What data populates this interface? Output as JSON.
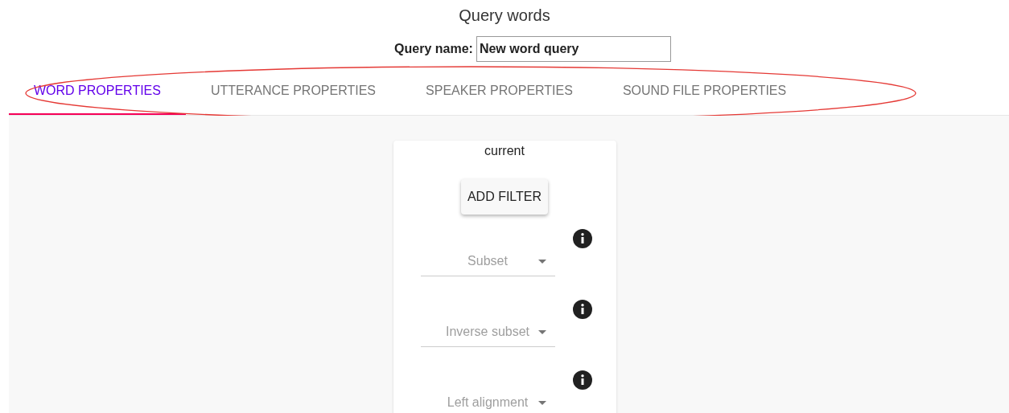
{
  "title": "Query words",
  "query_name": {
    "label": "Query name:",
    "value": "New word query"
  },
  "tabs": [
    {
      "label": "WORD PROPERTIES",
      "selected": true
    },
    {
      "label": "UTTERANCE PROPERTIES",
      "selected": false
    },
    {
      "label": "SPEAKER PROPERTIES",
      "selected": false
    },
    {
      "label": "SOUND FILE PROPERTIES",
      "selected": false
    }
  ],
  "card": {
    "heading": "current",
    "button": "ADD FILTER",
    "filters": [
      {
        "placeholder": "Subset"
      },
      {
        "placeholder": "Inverse subset"
      },
      {
        "placeholder": "Left alignment"
      }
    ]
  }
}
